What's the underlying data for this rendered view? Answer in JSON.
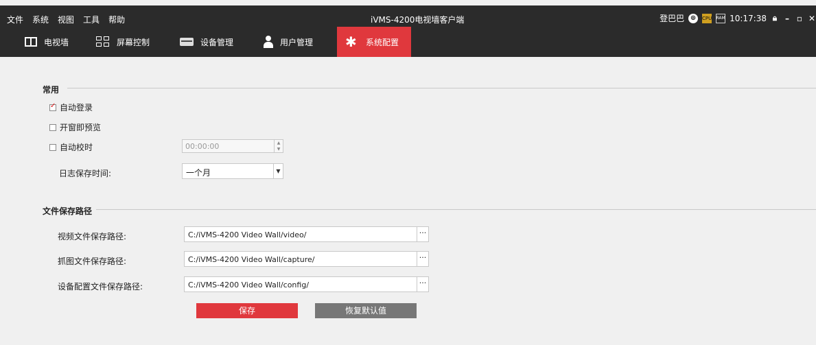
{
  "menubar": {
    "items": [
      "文件",
      "系统",
      "视图",
      "工具",
      "帮助"
    ]
  },
  "window": {
    "title": "iVMS-4200电视墙客户端"
  },
  "status": {
    "user": "登巴巴",
    "time": "10:17:38"
  },
  "nav": {
    "tabs": [
      {
        "label": "电视墙",
        "icon": "tv-wall-icon"
      },
      {
        "label": "屏幕控制",
        "icon": "screen-control-icon"
      },
      {
        "label": "设备管理",
        "icon": "device-icon"
      },
      {
        "label": "用户管理",
        "icon": "user-icon"
      },
      {
        "label": "系统配置",
        "icon": "gear-icon",
        "active": true
      }
    ]
  },
  "general": {
    "title": "常用",
    "auto_login": {
      "label": "自动登录",
      "checked": true
    },
    "preview_on_open": {
      "label": "开窗即预览",
      "checked": false
    },
    "auto_time_sync": {
      "label": "自动校时",
      "checked": false,
      "time_value": "00:00:00"
    },
    "log_retention": {
      "label": "日志保存时间:",
      "value": "一个月"
    }
  },
  "paths": {
    "title": "文件保存路径",
    "video": {
      "label": "视频文件保存路径:",
      "value": "C:/iVMS-4200 Video Wall/video/"
    },
    "capture": {
      "label": "抓图文件保存路径:",
      "value": "C:/iVMS-4200 Video Wall/capture/"
    },
    "config": {
      "label": "设备配置文件保存路径:",
      "value": "C:/iVMS-4200 Video Wall/config/"
    },
    "browse_label": "···"
  },
  "actions": {
    "save": "保存",
    "restore_defaults": "恢复默认值"
  },
  "colors": {
    "accent": "#e0383d",
    "titlebar": "#2b2b2b",
    "secondary_button": "#777777"
  }
}
